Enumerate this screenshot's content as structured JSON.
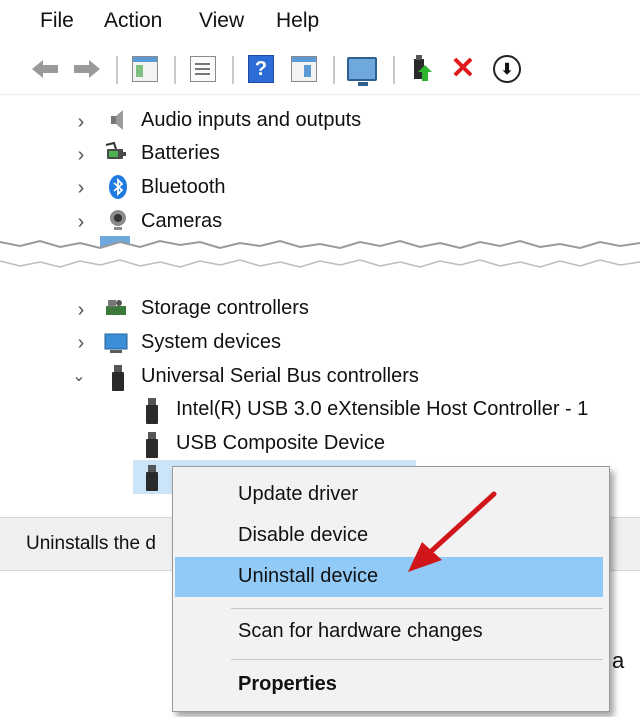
{
  "menu": {
    "file": "File",
    "action": "Action",
    "view": "View",
    "help": "Help"
  },
  "toolbar": {
    "icons": [
      "back-arrow-icon",
      "forward-arrow-icon",
      "console-tree-icon",
      "properties-icon",
      "help-icon",
      "action-pane-icon",
      "monitor-icon",
      "update-driver-icon",
      "uninstall-x-icon",
      "download-icon"
    ]
  },
  "tree": {
    "audio": "Audio inputs and outputs",
    "batteries": "Batteries",
    "bluetooth": "Bluetooth",
    "cameras": "Cameras",
    "storage": "Storage controllers",
    "system": "System devices",
    "usb_controllers": "Universal Serial Bus controllers",
    "usb_child_1": "Intel(R) USB 3.0 eXtensible Host Controller - 1",
    "usb_child_2": "USB Composite Device"
  },
  "status": {
    "text": "Uninstalls the d"
  },
  "context_menu": {
    "update": "Update driver",
    "disable": "Disable device",
    "uninstall": "Uninstall device",
    "scan": "Scan for hardware changes",
    "properties": "Properties"
  },
  "colors": {
    "highlight": "#91c9f7",
    "selected_row": "#cce4f7",
    "arrow": "#d0161b"
  },
  "corner_glyph": "a"
}
